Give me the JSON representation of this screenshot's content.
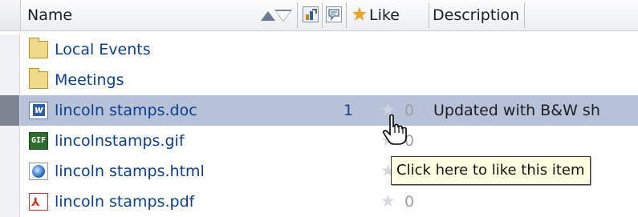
{
  "header": {
    "name_label": "Name",
    "like_label": "Like",
    "description_label": "Description"
  },
  "rows": [
    {
      "name": "Local Events",
      "icon": "folder-icon"
    },
    {
      "name": "Meetings",
      "icon": "folder-icon"
    },
    {
      "name": "lincoln stamps.doc",
      "icon": "word-doc-icon",
      "count": "1",
      "likes": "0",
      "description": "Updated with B&W sh",
      "selected": true
    },
    {
      "name": "lincolnstamps.gif",
      "icon": "gif-image-icon",
      "likes": "0"
    },
    {
      "name": "lincoln stamps.html",
      "icon": "html-page-icon",
      "likes": "0"
    },
    {
      "name": "lincoln stamps.pdf",
      "icon": "pdf-icon",
      "likes": "0"
    }
  ],
  "tooltip": "Click here to like this item",
  "colors": {
    "selected_row": "#b7c2d8",
    "link": "#0b3f8c",
    "star_gray": "#d6d8dc",
    "star_header": "#f0a21a"
  }
}
